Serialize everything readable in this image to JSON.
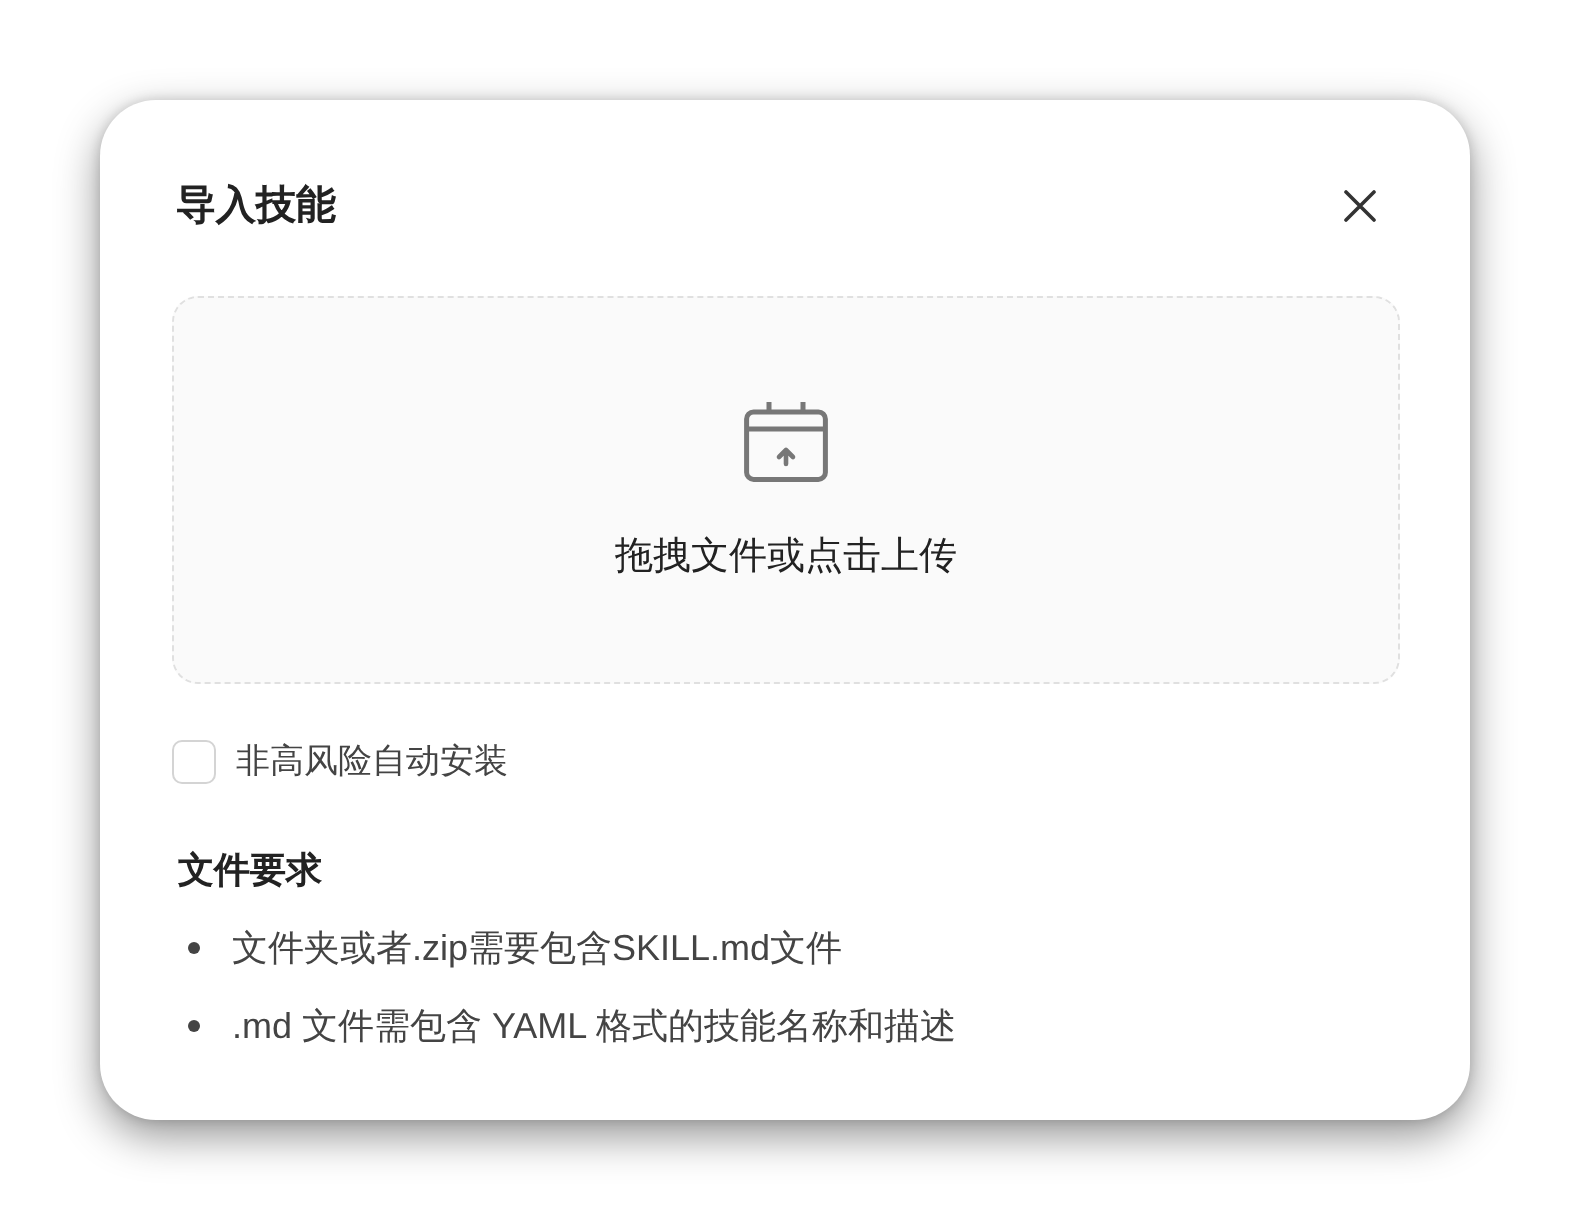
{
  "dialog": {
    "title": "导入技能"
  },
  "upload": {
    "label": "拖拽文件或点击上传"
  },
  "options": [
    {
      "kind": "checkbox",
      "label": "非高风险自动安装",
      "checked": false
    }
  ],
  "requirements": {
    "heading": "文件要求",
    "items": [
      "文件夹或者.zip需要包含SKILL.md文件",
      ".md 文件需包含 YAML 格式的技能名称和描述"
    ]
  }
}
